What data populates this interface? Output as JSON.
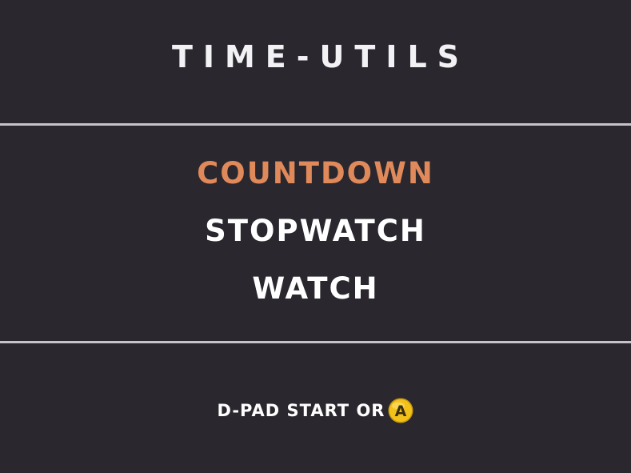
{
  "title": "TIME-UTILS",
  "menu": {
    "items": [
      {
        "label": "COUNTDOWN",
        "selected": true
      },
      {
        "label": "STOPWATCH",
        "selected": false
      },
      {
        "label": "WATCH",
        "selected": false
      }
    ]
  },
  "hint": {
    "text": "D-PAD START OR",
    "button_icon": "a-button-icon",
    "button_letter": "A"
  },
  "colors": {
    "background": "#2a272e",
    "text": "#ffffff",
    "selected": "#e0895a",
    "divider": "#c4c3c8",
    "a_button": "#f2c21a"
  }
}
